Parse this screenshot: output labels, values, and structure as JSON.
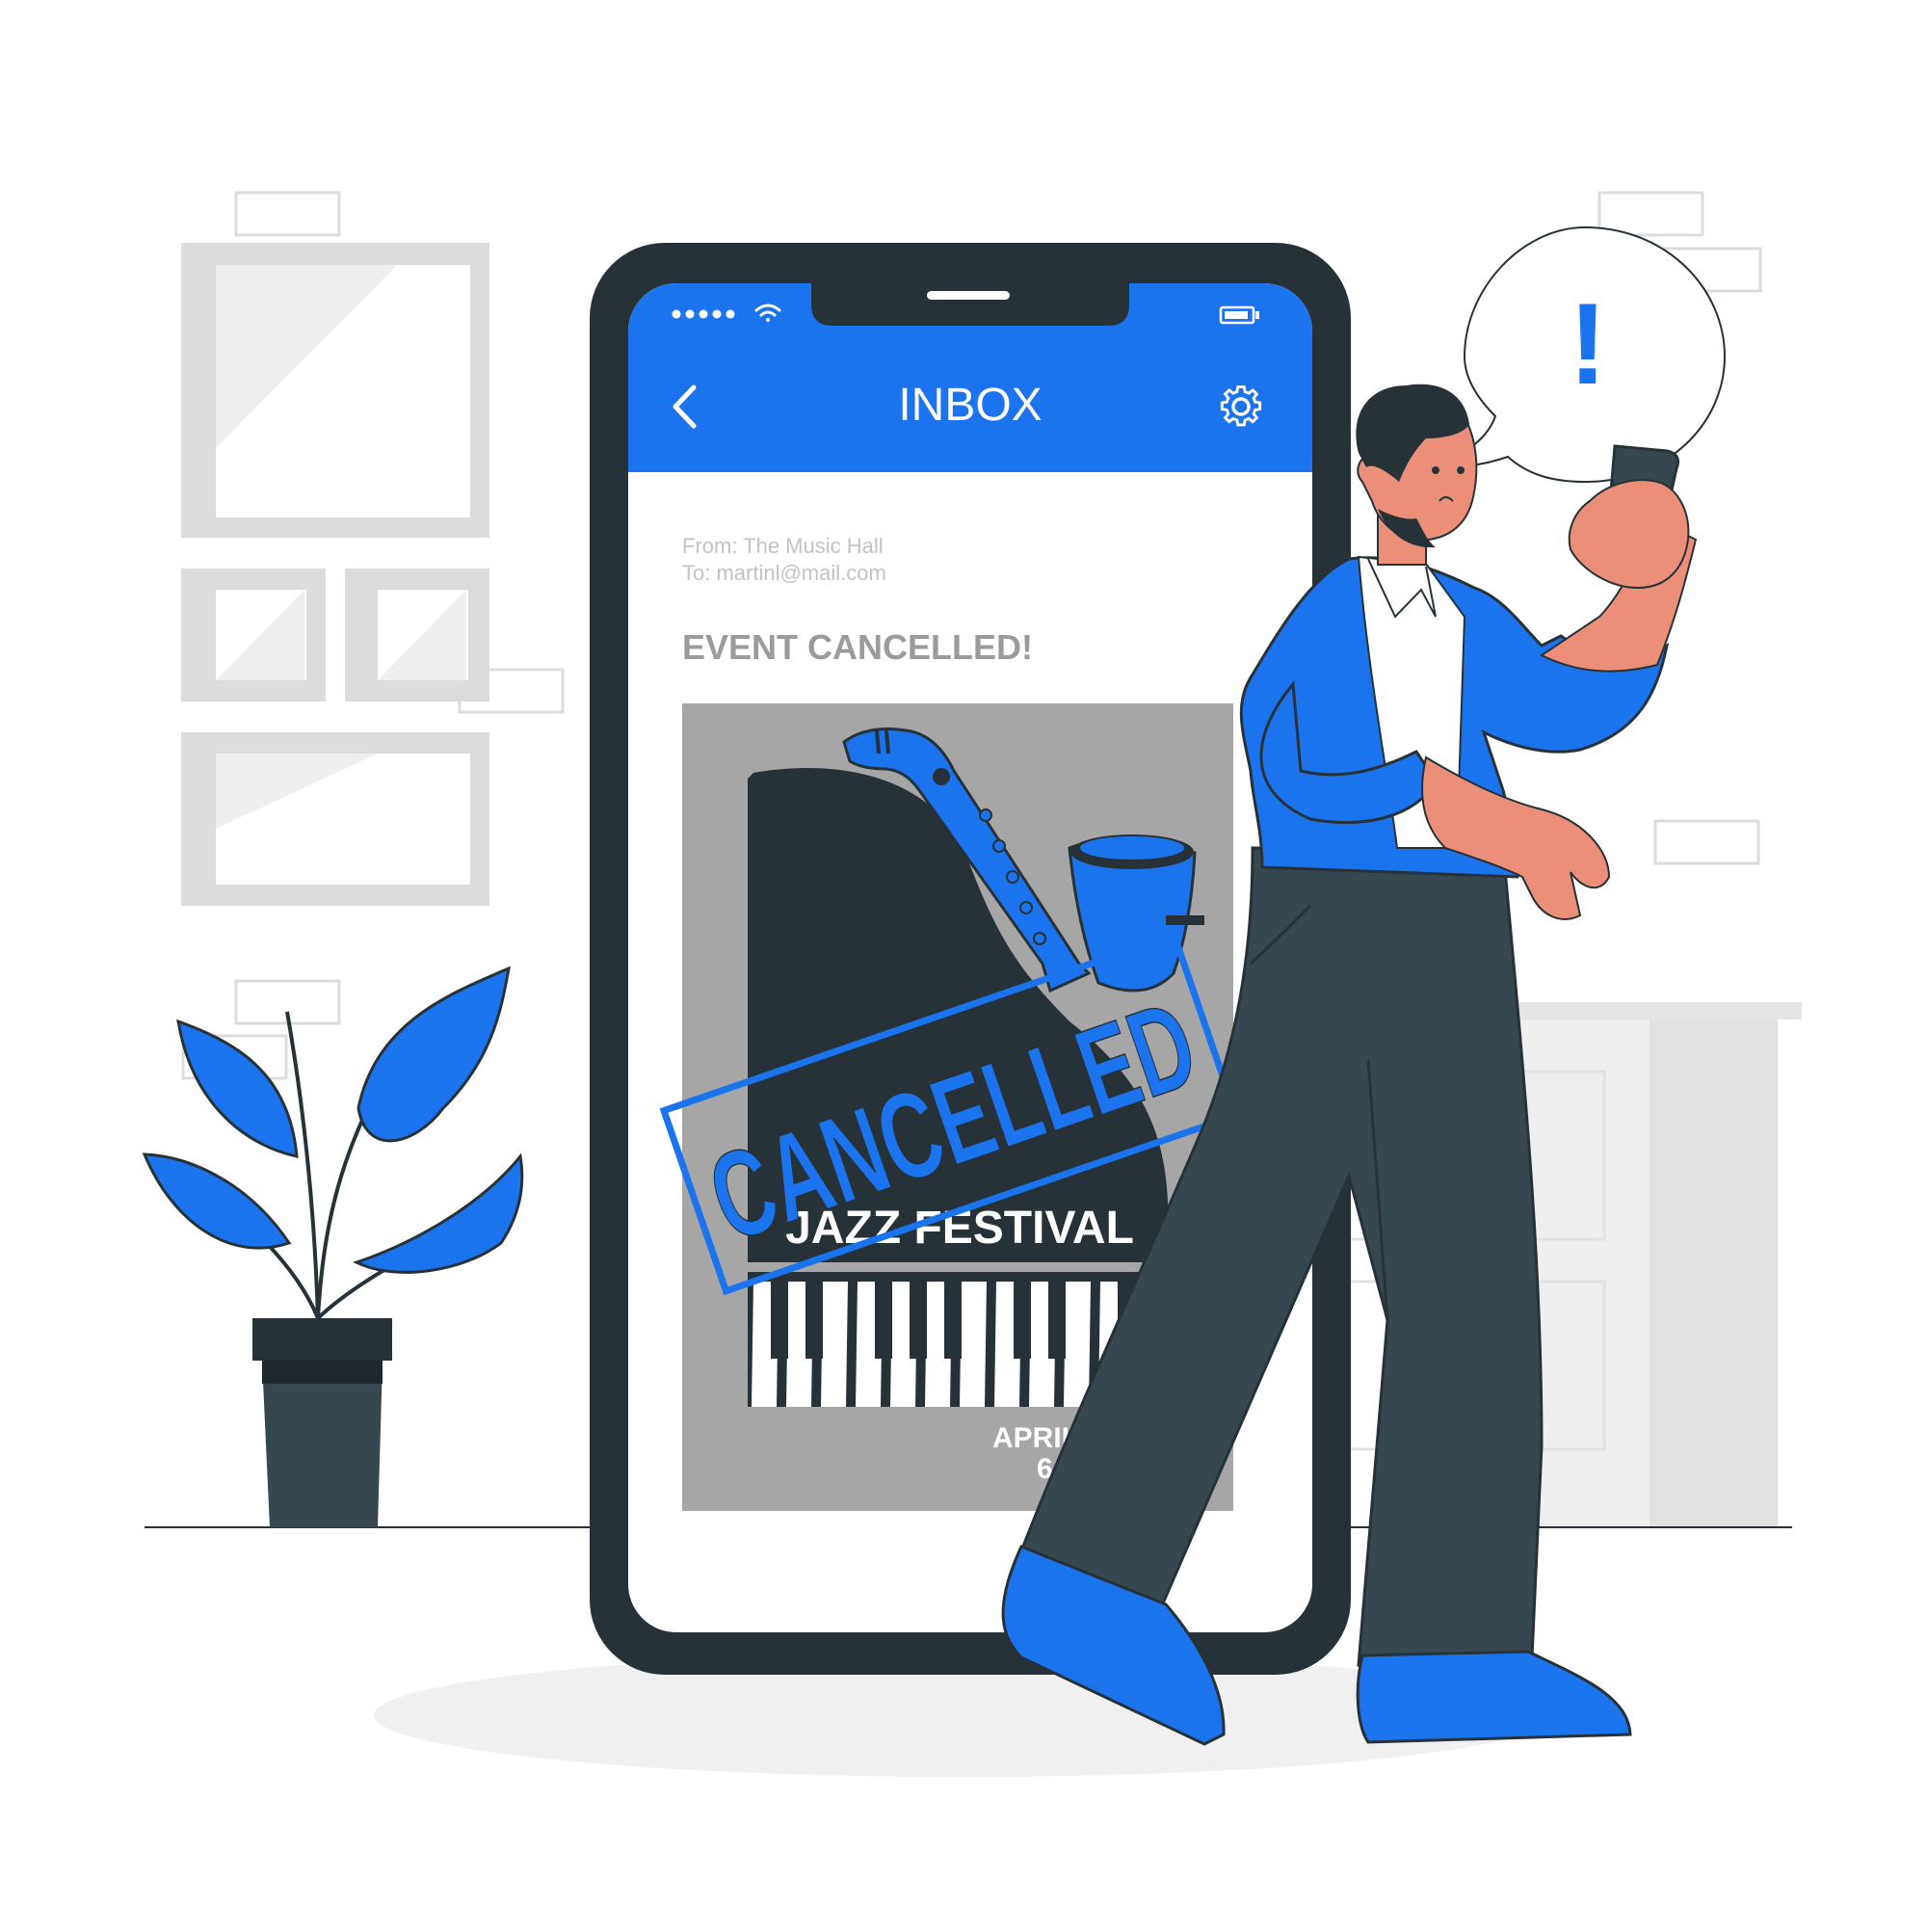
{
  "colors": {
    "accent": "#1b74ee",
    "dark": "#263238",
    "pants": "#37474f",
    "skin": "#eb8f79",
    "wall_gray": "#dcdcdc",
    "poster_gray": "#a6a6a6",
    "meta_text": "#c3c3c3",
    "subject_text": "#9b9b9b"
  },
  "header": {
    "title": "INBOX",
    "back_icon": "chevron-left-icon",
    "settings_icon": "gear-icon"
  },
  "status_bar": {
    "signal_icon": "signal-dots-icon",
    "wifi_icon": "wifi-icon",
    "battery_icon": "battery-icon"
  },
  "email": {
    "from": "From: The Music Hall",
    "to": "To: martinl@mail.com",
    "subject": "EVENT CANCELLED!"
  },
  "poster": {
    "title": "JAZZ FESTIVAL",
    "date_month": "APRIL",
    "date_day": "6",
    "stamp": "CANCELLED"
  },
  "speech_bubble": {
    "symbol": "!"
  }
}
